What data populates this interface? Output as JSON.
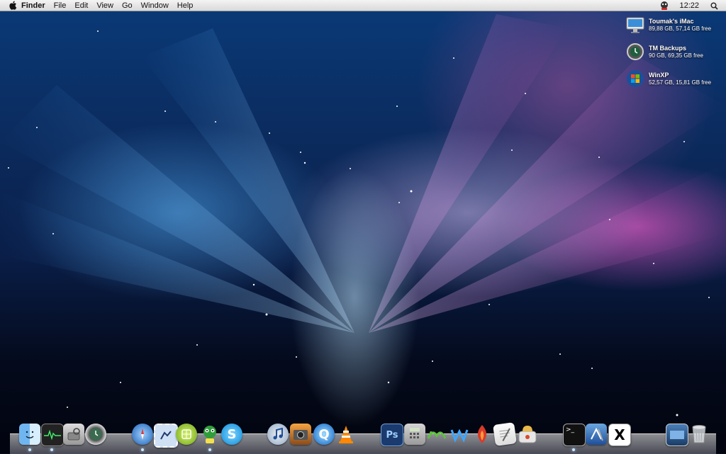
{
  "menubar": {
    "apple_icon": "apple-logo-icon",
    "app_name": "Finder",
    "menus": [
      "File",
      "Edit",
      "View",
      "Go",
      "Window",
      "Help"
    ],
    "status_icon": "chat-status-icon",
    "clock": "12:22",
    "spotlight_icon": "search-icon"
  },
  "desktop": {
    "drives": [
      {
        "name": "Toumak's iMac",
        "info": "89,88 GB, 57,14 GB free",
        "icon": "imac-icon"
      },
      {
        "name": "TM Backups",
        "info": "90 GB, 69,35 GB free",
        "icon": "time-machine-icon"
      },
      {
        "name": "WinXP",
        "info": "52,57 GB, 15,81 GB free",
        "icon": "windows-icon"
      }
    ]
  },
  "dock": {
    "apps": [
      {
        "id": "finder",
        "icon": "finder-icon",
        "running": true
      },
      {
        "id": "activity-monitor",
        "icon": "activity-monitor-icon",
        "running": true
      },
      {
        "id": "disk-utility",
        "icon": "disk-utility-icon",
        "running": false
      },
      {
        "id": "time-machine",
        "icon": "time-machine-icon",
        "running": false
      },
      {
        "id": "safari",
        "icon": "safari-icon",
        "running": true
      },
      {
        "id": "mail",
        "icon": "mail-stamp-icon",
        "running": false
      },
      {
        "id": "chat",
        "icon": "chat-app-icon",
        "running": false
      },
      {
        "id": "adium",
        "icon": "adium-icon",
        "running": true
      },
      {
        "id": "skype",
        "icon": "skype-icon",
        "running": false
      },
      {
        "id": "itunes",
        "icon": "itunes-icon",
        "running": false
      },
      {
        "id": "iphoto",
        "icon": "iphoto-icon",
        "running": false
      },
      {
        "id": "quicktime",
        "icon": "quicktime-icon",
        "running": false
      },
      {
        "id": "vlc",
        "icon": "vlc-icon",
        "running": false
      },
      {
        "id": "photoshop",
        "icon": "photoshop-icon",
        "running": false
      },
      {
        "id": "calculator",
        "icon": "calculator-icon",
        "running": false
      },
      {
        "id": "cyberduck",
        "icon": "cyberduck-icon",
        "running": false
      },
      {
        "id": "wasp",
        "icon": "wasp-icon",
        "running": false
      },
      {
        "id": "transmit",
        "icon": "transmit-icon",
        "running": false
      },
      {
        "id": "textedit",
        "icon": "textedit-icon",
        "running": false
      },
      {
        "id": "toast",
        "icon": "toast-icon",
        "running": false
      },
      {
        "id": "terminal",
        "icon": "terminal-icon",
        "running": true
      },
      {
        "id": "xcode",
        "icon": "xcode-icon",
        "running": false
      },
      {
        "id": "x11",
        "icon": "x11-icon",
        "running": false
      },
      {
        "id": "downloads",
        "icon": "downloads-stack-icon",
        "running": false
      },
      {
        "id": "trash",
        "icon": "trash-icon",
        "running": false
      }
    ],
    "labels": {
      "photoshop": "Ps",
      "x11": "X",
      "terminal": ">_"
    }
  }
}
